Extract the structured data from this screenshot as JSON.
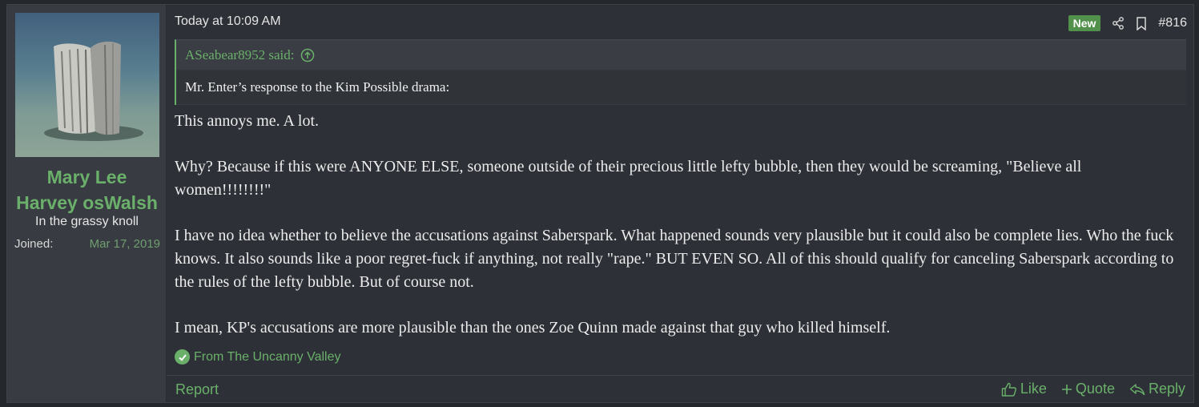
{
  "user": {
    "name_line1": "Mary Lee",
    "name_line2": "Harvey osWalsh",
    "title": "In the grassy knoll",
    "joined_label": "Joined:",
    "joined_value": "Mar 17, 2019"
  },
  "post": {
    "timestamp": "Today at 10:09 AM",
    "new_badge": "New",
    "number": "#816",
    "quote": {
      "author": "ASeabear8952 said:",
      "text": "Mr. Enter’s response to the Kim Possible drama:"
    },
    "paragraphs": [
      "This annoys me. A lot.",
      "Why? Because if this were ANYONE ELSE, someone outside of their precious little lefty bubble, then they would be screaming, \"Believe all women!!!!!!!!\"",
      "I have no idea whether to believe the accusations against Saberspark. What happened sounds very plausible but it could also be complete lies. Who the fuck knows. It also sounds like a poor regret-fuck if anything, not really \"rape.\" BUT EVEN SO. All of this should qualify for canceling Saberspark according to the rules of the lefty bubble. But of course not.",
      "I mean, KP's accusations are more plausible than the ones Zoe Quinn made against that guy who killed himself."
    ],
    "signature": "From The Uncanny Valley"
  },
  "footer": {
    "report": "Report",
    "like": "Like",
    "quote": "Quote",
    "reply": "Reply"
  },
  "icons": {
    "share": "share-icon",
    "bookmark": "bookmark-icon",
    "up_arrow": "arrow-up-circle-icon",
    "check": "check-circle-icon",
    "like": "thumbs-up-icon",
    "quote": "plus-icon",
    "reply": "reply-icon"
  },
  "colors": {
    "accent": "#6ab06a",
    "new_badge": "#52914c",
    "panel": "#2d3036",
    "sidebar": "#383b42"
  }
}
